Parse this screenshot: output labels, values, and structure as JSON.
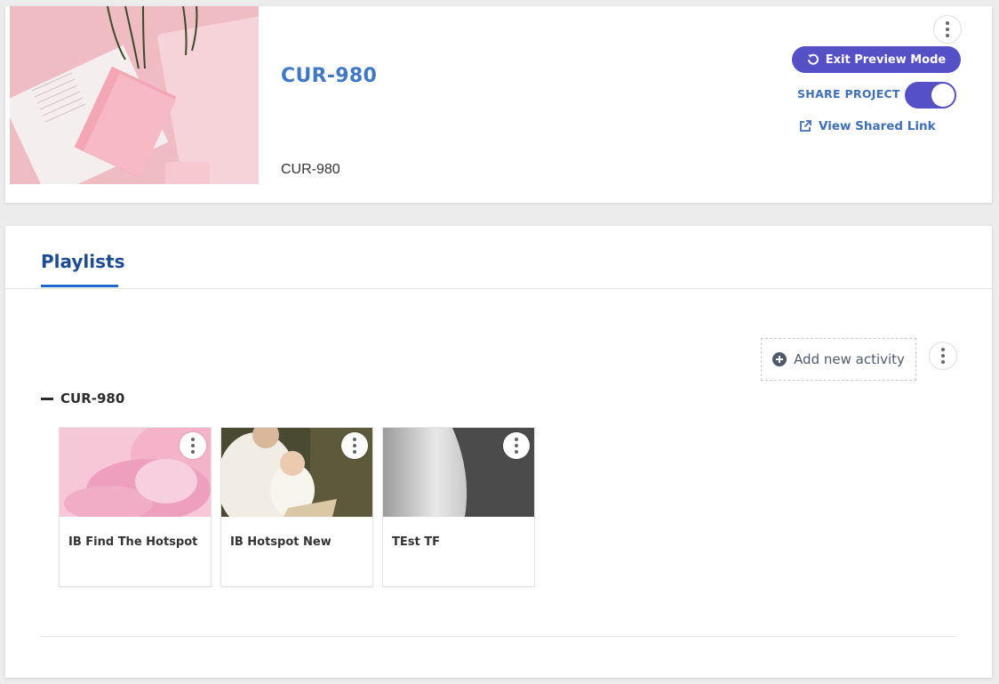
{
  "project": {
    "title": "CUR-980",
    "description": "CUR-980",
    "exit_preview_label": "Exit Preview Mode",
    "share_label": "SHARE PROJECT",
    "share_enabled": true,
    "view_shared_link_label": "View Shared Link"
  },
  "tabs": [
    {
      "label": "Playlists",
      "active": true
    }
  ],
  "playlist_section": {
    "add_activity_label": "Add new activity",
    "playlists": [
      {
        "title": "CUR-980",
        "activities": [
          {
            "title": "IB Find The Hotspot",
            "thumbnail": "pink-flower"
          },
          {
            "title": "IB Hotspot New",
            "thumbnail": "mother-and-baby-reading"
          },
          {
            "title": "TEst TF",
            "thumbnail": "grey-gradient"
          }
        ]
      }
    ]
  },
  "colors": {
    "accent": "#5650c6",
    "title_blue": "#3f78c4",
    "tab_blue": "#1e4c94"
  }
}
